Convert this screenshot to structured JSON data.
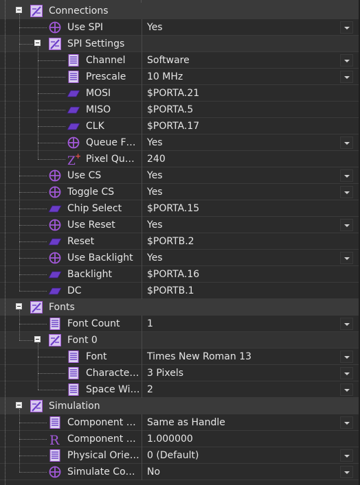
{
  "sections": [
    {
      "title": "Connections",
      "items": [
        {
          "kind": "prop",
          "label": "Use SPI",
          "value": "Yes",
          "icon": "bool-icon",
          "dropdown": true
        },
        {
          "kind": "group",
          "label": "SPI Settings",
          "icon": "settings-group-icon",
          "children": [
            {
              "label": "Channel",
              "value": "Software",
              "icon": "list-icon",
              "dropdown": true
            },
            {
              "label": "Prescale",
              "value": "10 MHz",
              "icon": "list-icon",
              "dropdown": true
            },
            {
              "label": "MOSI",
              "value": "$PORTA.21",
              "icon": "pin-icon",
              "dropdown": false
            },
            {
              "label": "MISO",
              "value": "$PORTA.5",
              "icon": "pin-icon",
              "dropdown": false
            },
            {
              "label": "CLK",
              "value": "$PORTA.17",
              "icon": "pin-icon",
              "dropdown": false
            },
            {
              "label": "Queue F…",
              "value": "Yes",
              "icon": "bool-icon",
              "dropdown": true
            },
            {
              "label": "Pixel Que…",
              "value": "240",
              "icon": "int-icon",
              "dropdown": false
            }
          ]
        },
        {
          "kind": "prop",
          "label": "Use CS",
          "value": "Yes",
          "icon": "bool-icon",
          "dropdown": true
        },
        {
          "kind": "prop",
          "label": "Toggle CS",
          "value": "Yes",
          "icon": "bool-icon",
          "dropdown": true
        },
        {
          "kind": "prop",
          "label": "Chip Select",
          "value": "$PORTA.15",
          "icon": "pin-icon",
          "dropdown": false
        },
        {
          "kind": "prop",
          "label": "Use Reset",
          "value": "Yes",
          "icon": "bool-icon",
          "dropdown": true
        },
        {
          "kind": "prop",
          "label": "Reset",
          "value": "$PORTB.2",
          "icon": "pin-icon",
          "dropdown": false
        },
        {
          "kind": "prop",
          "label": "Use Backlight",
          "value": "Yes",
          "icon": "bool-icon",
          "dropdown": true
        },
        {
          "kind": "prop",
          "label": "Backlight",
          "value": "$PORTA.16",
          "icon": "pin-icon",
          "dropdown": false
        },
        {
          "kind": "prop",
          "label": "DC",
          "value": "$PORTB.1",
          "icon": "pin-icon",
          "dropdown": false
        }
      ]
    },
    {
      "title": "Fonts",
      "items": [
        {
          "kind": "prop",
          "label": "Font Count",
          "value": "1",
          "icon": "list-icon",
          "dropdown": true
        },
        {
          "kind": "group",
          "label": "Font 0",
          "icon": "settings-group-icon",
          "children": [
            {
              "label": "Font",
              "value": "Times New Roman 13",
              "icon": "list-icon",
              "dropdown": true
            },
            {
              "label": "Characte…",
              "value": "3 Pixels",
              "icon": "list-icon",
              "dropdown": true
            },
            {
              "label": "Space Wi…",
              "value": "2",
              "icon": "list-icon",
              "dropdown": true
            }
          ]
        }
      ]
    },
    {
      "title": "Simulation",
      "items": [
        {
          "kind": "prop",
          "label": "Component L…",
          "value": "Same as Handle",
          "icon": "list-icon",
          "dropdown": true
        },
        {
          "kind": "prop",
          "label": "Component L…",
          "value": "1.000000",
          "icon": "real-icon",
          "dropdown": false
        },
        {
          "kind": "prop",
          "label": "Physical Orien…",
          "value": "0 (Default)",
          "icon": "list-icon",
          "dropdown": true
        },
        {
          "kind": "prop",
          "label": "Simulate Com…",
          "value": "No",
          "icon": "bool-icon",
          "dropdown": true
        }
      ]
    }
  ],
  "colors": {
    "icon_purple": "#a259d9",
    "pin_purple": "#6a3cc8",
    "int_red": "#e0504a"
  }
}
